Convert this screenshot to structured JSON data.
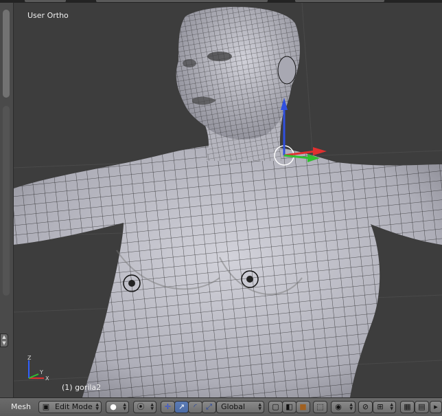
{
  "viewport": {
    "view_label": "User Ortho",
    "object_label": "(1) gorila2",
    "axes": {
      "x": "X",
      "y": "Y",
      "z": "Z"
    }
  },
  "header": {
    "menu_mesh": "Mesh",
    "mode": "Edit Mode",
    "orientation": "Global"
  },
  "colors": {
    "viewport_bg": "#3d3d3d",
    "mesh_fill": "#b9b9c2",
    "wire": "#111111",
    "manipulator_x": "#e03030",
    "manipulator_y": "#30c030",
    "manipulator_z": "#3050e0",
    "selected_button": "#5c7cb6"
  },
  "icons": {
    "editor_type": "3d-view-icon",
    "viewport_shading": "solid-sphere-icon",
    "pivot_point": "pivot-icon",
    "manipulator_toggle": "manipulator-icon",
    "translate": "translate-arrow-icon",
    "rotate": "rotate-arc-icon",
    "scale": "scale-icon",
    "layers": "cube-icons",
    "proportional": "proportional-circle-icon",
    "snap": "magnet-icon",
    "render": "render-icon"
  }
}
